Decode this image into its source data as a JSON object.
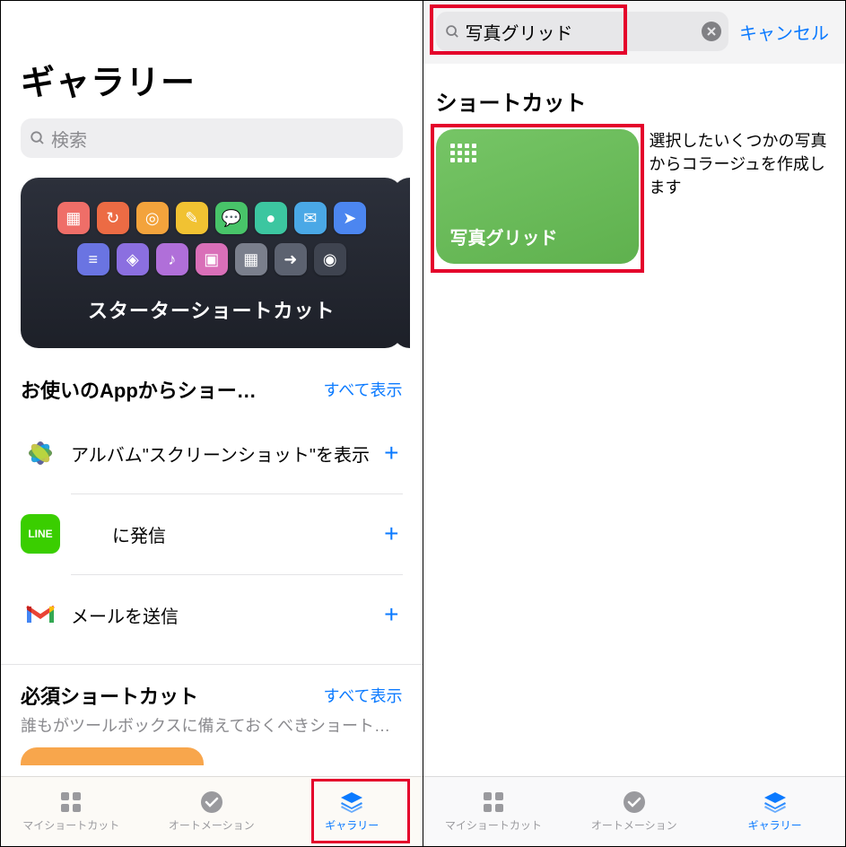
{
  "left": {
    "title": "ギャラリー",
    "search_placeholder": "検索",
    "starter_title": "スターターショートカット",
    "section1": {
      "title": "お使いのAppからショー…",
      "see_all": "すべて表示",
      "items": [
        {
          "icon": "photos",
          "label": "アルバム\"スクリーンショット\"を表示"
        },
        {
          "icon": "line",
          "label": "に発信"
        },
        {
          "icon": "gmail",
          "label": "メールを送信"
        }
      ]
    },
    "section2": {
      "title": "必須ショートカット",
      "see_all": "すべて表示",
      "desc": "誰もがツールボックスに備えておくべきショート…"
    }
  },
  "right": {
    "search_value": "写真グリッド",
    "cancel": "キャンセル",
    "section_title": "ショートカット",
    "result": {
      "title": "写真グリッド",
      "desc": "選択したいくつかの写真からコラージュを作成します"
    }
  },
  "tabs": [
    {
      "id": "my",
      "label": "マイショートカット"
    },
    {
      "id": "auto",
      "label": "オートメーション"
    },
    {
      "id": "gallery",
      "label": "ギャラリー"
    }
  ],
  "starter_icons": [
    {
      "c": "#ef6e68"
    },
    {
      "c": "#ec6b44"
    },
    {
      "c": "#f3a33c"
    },
    {
      "c": "#f1c232"
    },
    {
      "c": "#48c469"
    },
    {
      "c": "#3cc6a0"
    },
    {
      "c": "#4aa8e6"
    },
    {
      "c": "#4c86f0"
    },
    {
      "c": "#6a74e2"
    },
    {
      "c": "#8b6fe0"
    },
    {
      "c": "#b06fd9"
    },
    {
      "c": "#d96fb8"
    },
    {
      "c": "#7a7f8c"
    },
    {
      "c": "#5c6270"
    },
    {
      "c": "#3f4450"
    }
  ]
}
